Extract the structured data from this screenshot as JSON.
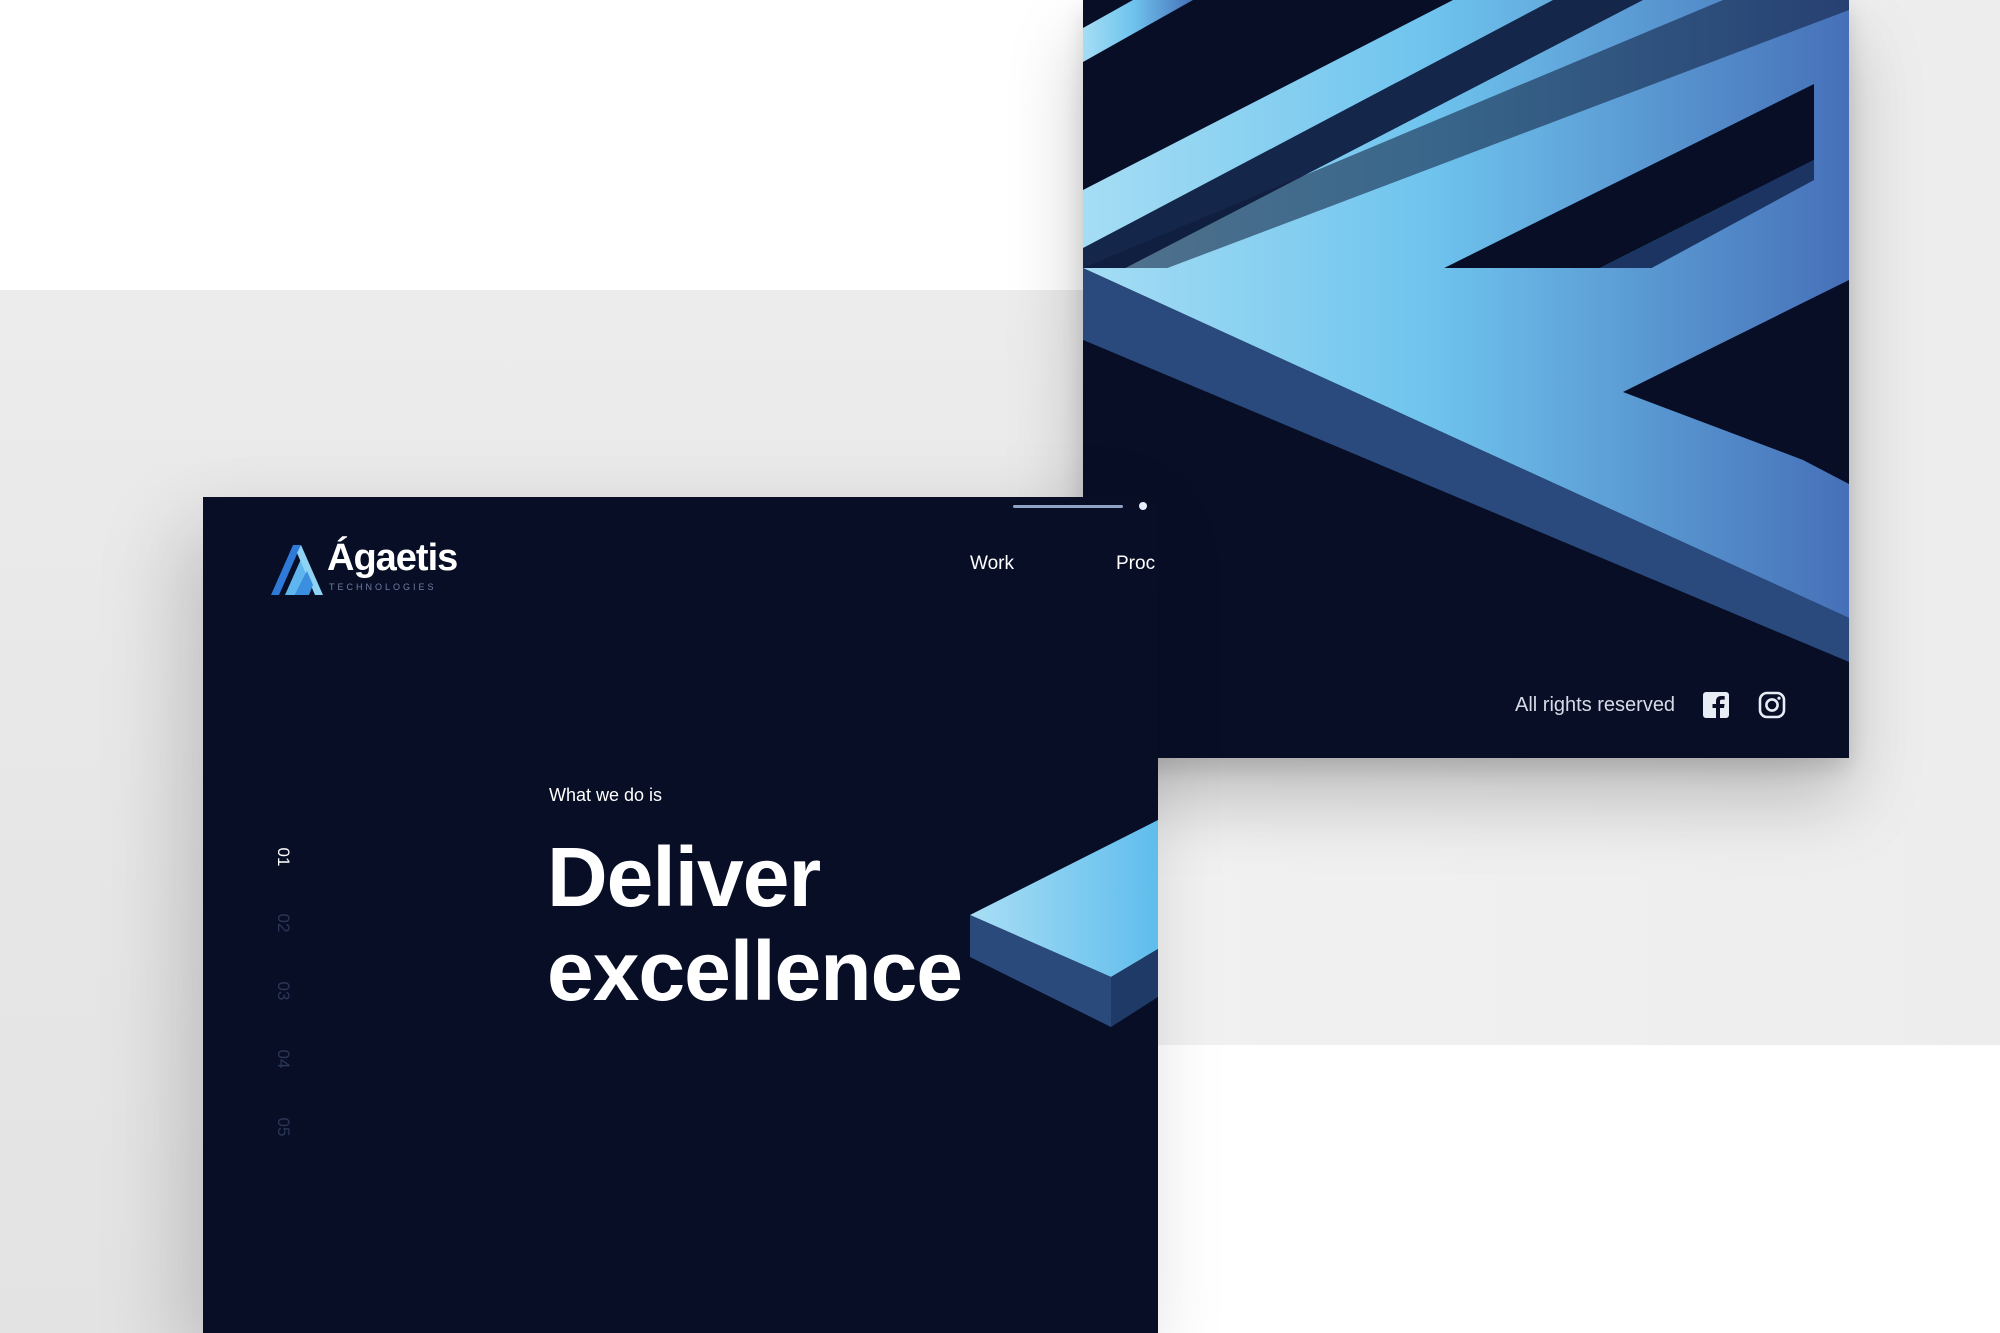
{
  "brand": {
    "name": "Ágaetis",
    "tagline": "TECHNOLOGIES"
  },
  "nav": {
    "items": [
      {
        "label": "Work"
      },
      {
        "label": "Proc"
      }
    ]
  },
  "hero": {
    "kicker": "What we do is",
    "headline_line1": "Deliver",
    "headline_line2": "excellence"
  },
  "slides": {
    "items": [
      "01",
      "02",
      "03",
      "04",
      "05"
    ],
    "active_index": 0
  },
  "footer": {
    "rights": "All rights reserved",
    "social": [
      "facebook-icon",
      "instagram-icon"
    ]
  },
  "colors": {
    "navy": "#070e26",
    "accent_light": "#87d2f1",
    "accent_dark": "#4a76bc",
    "slide_inactive": "#2c3757"
  }
}
